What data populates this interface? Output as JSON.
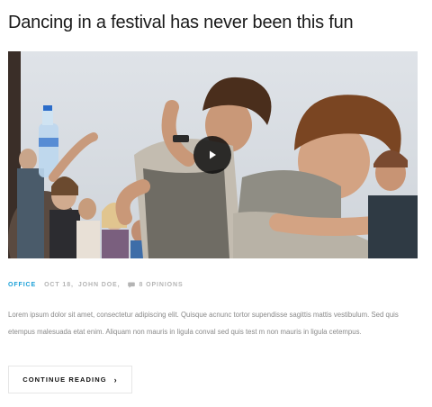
{
  "post": {
    "title": "Dancing in a festival has never been this fun",
    "category": "Office",
    "date": "Oct 18",
    "author": "John Doe",
    "comments": "8 Opinions",
    "excerpt": "Lorem ipsum dolor sit amet, consectetur adipiscing elit. Quisque acnunc tortor supendisse sagittis mattis vestibulum. Sed quis etempus malesuada etat enim. Aliquam non mauris in ligula conval sed quis test m non mauris in ligula cetempus.",
    "read_more": "Continue Reading",
    "read_more_icon": "chevron-right-icon"
  },
  "colors": {
    "category": "#1ba0d8",
    "meta": "#b4b4b4",
    "excerpt": "#8a8a8a",
    "title": "#1a1a1a"
  }
}
